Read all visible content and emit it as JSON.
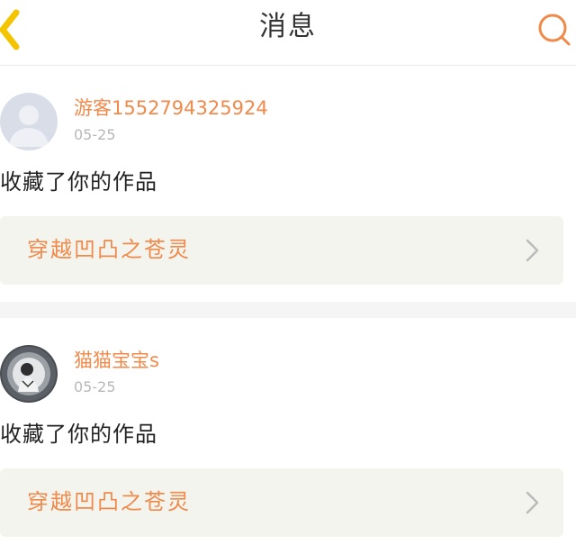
{
  "header": {
    "title": "消息",
    "back_icon": "chevron-left-icon",
    "search_icon": "search-icon"
  },
  "colors": {
    "accent": "#f08a4b",
    "back_arrow": "#f5c400",
    "work_bar_bg": "#f4f4ee"
  },
  "notifications": [
    {
      "user_name": "游客1552794325924",
      "date": "05-25",
      "avatar": "default-user-icon",
      "action": "收藏了你的作品",
      "work_title": "穿越凹凸之苍灵"
    },
    {
      "user_name": "猫猫宝宝s",
      "date": "05-25",
      "avatar": "user-photo",
      "action": "收藏了你的作品",
      "work_title": "穿越凹凸之苍灵"
    }
  ]
}
